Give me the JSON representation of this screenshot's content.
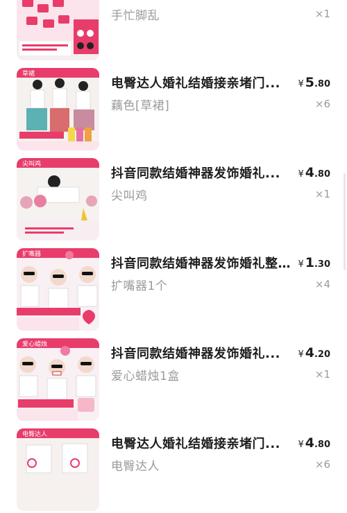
{
  "items": [
    {
      "title": "",
      "spec": "手忙脚乱",
      "price_currency": "¥",
      "price_int": "",
      "price_dec": "",
      "qty": "×1",
      "thumb_caption": "",
      "thumb_color": "#e83c6b"
    },
    {
      "title": "电臀达人婚礼结婚接亲堵门...",
      "spec": "藕色[草裙]",
      "price_currency": "¥",
      "price_int": "5",
      "price_dec": ".80",
      "qty": "×6",
      "thumb_caption": "草裙",
      "thumb_color": "#e83c6b"
    },
    {
      "title": "抖音同款结婚神器发饰婚礼...",
      "spec": "尖叫鸡",
      "price_currency": "¥",
      "price_int": "4",
      "price_dec": ".80",
      "qty": "×1",
      "thumb_caption": "尖叫鸡",
      "thumb_color": "#e83c6b"
    },
    {
      "title": "抖音同款结婚神器发饰婚礼整...",
      "spec": "扩嘴器1个",
      "price_currency": "¥",
      "price_int": "1",
      "price_dec": ".30",
      "qty": "×4",
      "thumb_caption": "扩嘴器",
      "thumb_color": "#e83c6b"
    },
    {
      "title": "抖音同款结婚神器发饰婚礼...",
      "spec": "爱心蜡烛1盒",
      "price_currency": "¥",
      "price_int": "4",
      "price_dec": ".20",
      "qty": "×1",
      "thumb_caption": "爱心蜡烛",
      "thumb_color": "#e83c6b"
    },
    {
      "title": "电臀达人婚礼结婚接亲堵门...",
      "spec": "电臀达人",
      "price_currency": "¥",
      "price_int": "4",
      "price_dec": ".80",
      "qty": "×6",
      "thumb_caption": "电臀达人",
      "thumb_color": "#e83c6b"
    }
  ]
}
